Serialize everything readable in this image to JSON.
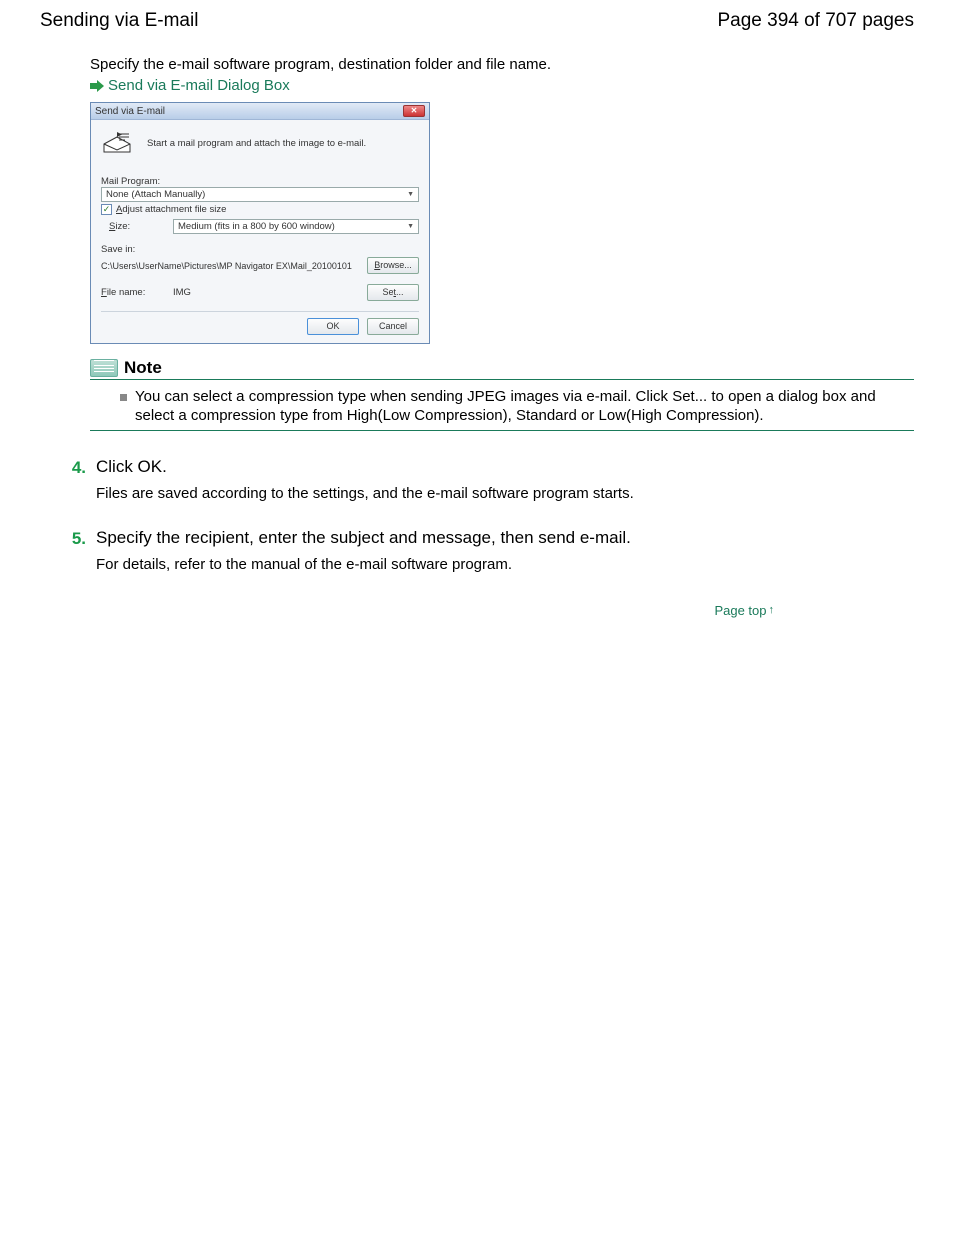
{
  "header": {
    "title": "Sending via E-mail",
    "page_counter": "Page 394 of 707 pages"
  },
  "intro_text": "Specify the e-mail software program, destination folder and file name.",
  "cross_ref": "Send via E-mail Dialog Box",
  "dialog": {
    "title": "Send via E-mail",
    "description": "Start a mail program and attach the image to e-mail.",
    "mail_program_label": "Mail Program:",
    "mail_program_value": "None (Attach Manually)",
    "adjust_label_pre": "A",
    "adjust_label_post": "djust attachment file size",
    "size_label_pre": "S",
    "size_label_post": "ize:",
    "size_value": "Medium (fits in a 800 by 600 window)",
    "save_in_label": "Save in:",
    "save_path": "C:\\Users\\UserName\\Pictures\\MP Navigator EX\\Mail_20100101",
    "browse_pre": "B",
    "browse_post": "rowse...",
    "file_name_label_pre": "F",
    "file_name_label_post": "ile name:",
    "file_name_value": "IMG",
    "set_pre": "Se",
    "set_mid": "t",
    "set_post": "...",
    "ok_label": "OK",
    "cancel_label": "Cancel"
  },
  "note": {
    "heading": "Note",
    "text": "You can select a compression type when sending JPEG images via e-mail. Click Set... to open a dialog box and select a compression type from High(Low Compression), Standard or Low(High Compression)."
  },
  "steps": [
    {
      "num": "4.",
      "title": "Click OK.",
      "para": "Files are saved according to the settings, and the e-mail software program starts."
    },
    {
      "num": "5.",
      "title": "Specify the recipient, enter the subject and message, then send e-mail.",
      "para": "For details, refer to the manual of the e-mail software program."
    }
  ],
  "page_top_label": "Page top"
}
